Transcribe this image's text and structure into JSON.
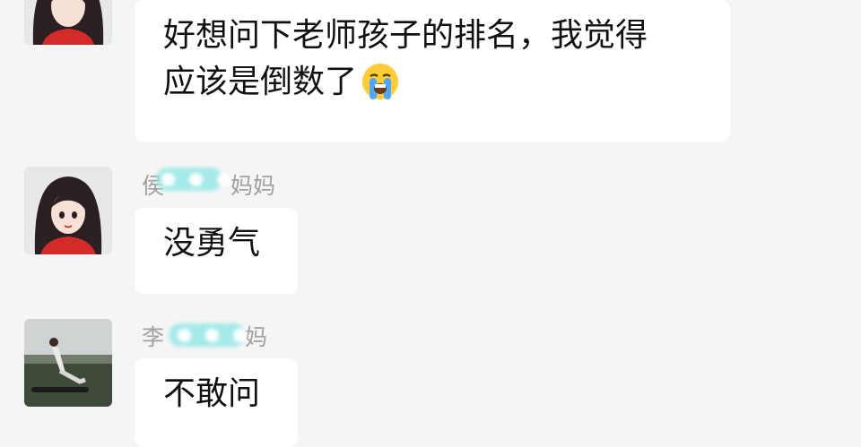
{
  "messages": [
    {
      "text": "好想问下老师孩子的排名，我觉得",
      "text2": "应该是倒数了",
      "emoji": "loudly-crying-emoji"
    },
    {
      "name_prefix": "侯",
      "name_suffix": "妈妈",
      "text": "没勇气"
    },
    {
      "name_prefix": "李",
      "name_suffix": "妈",
      "text": "不敢问"
    }
  ],
  "colors": {
    "background": "#f5f5f5",
    "bubble": "#ffffff",
    "name": "#a0a0a0",
    "text": "#111111",
    "blur": "#96e8e8"
  }
}
